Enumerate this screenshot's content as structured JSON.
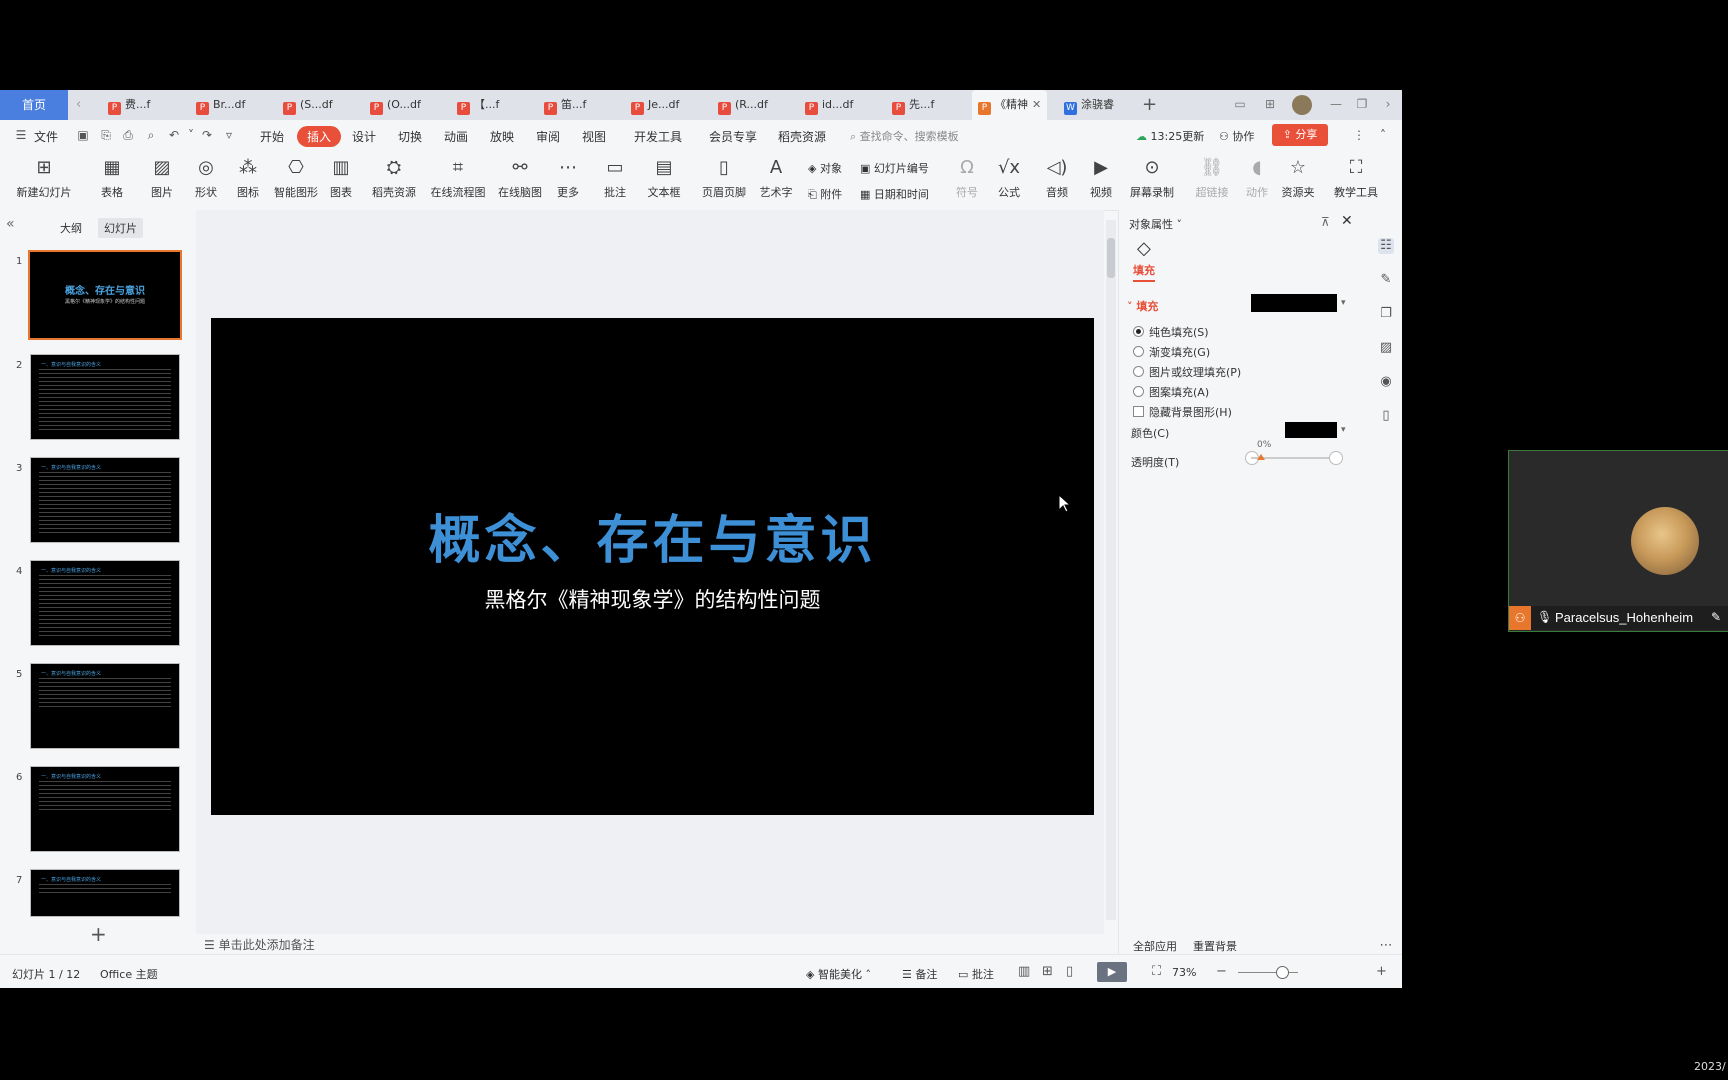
{
  "tabbar": {
    "home": "首页",
    "tabs": [
      {
        "label": "费...f",
        "type": "pdf"
      },
      {
        "label": "Br...df",
        "type": "pdf"
      },
      {
        "label": "(S...df",
        "type": "pdf"
      },
      {
        "label": "(O...df",
        "type": "pdf"
      },
      {
        "label": "【...f",
        "type": "pdf"
      },
      {
        "label": "笛...f",
        "type": "pdf"
      },
      {
        "label": "Je...df",
        "type": "pdf"
      },
      {
        "label": "(R...df",
        "type": "pdf"
      },
      {
        "label": "id...df",
        "type": "pdf"
      },
      {
        "label": "先...f",
        "type": "pdf"
      },
      {
        "label": "《精神",
        "type": "ppt"
      },
      {
        "label": "涂骁睿",
        "type": "wps"
      }
    ],
    "plus": "+"
  },
  "menubar": {
    "file": "文件",
    "items": [
      "开始",
      "插入",
      "设计",
      "切换",
      "动画",
      "放映",
      "审阅",
      "视图",
      "开发工具",
      "会员专享",
      "稻壳资源"
    ],
    "active": "插入",
    "search_placeholder": "查找命令、搜索模板",
    "sync_time": "13:25更新",
    "collab": "协作",
    "share": "分享"
  },
  "ribbon": {
    "items": [
      "新建幻灯片",
      "表格",
      "图片",
      "形状",
      "图标",
      "智能图形",
      "图表",
      "稻壳资源",
      "在线流程图",
      "在线脑图",
      "更多",
      "批注",
      "文本框",
      "页眉页脚",
      "艺术字"
    ],
    "small": [
      "对象",
      "附件",
      "幻灯片编号",
      "日期和时间"
    ],
    "right_items": [
      "符号",
      "公式",
      "音频",
      "视频",
      "屏幕录制",
      "超链接",
      "动作",
      "资源夹",
      "教学工具"
    ]
  },
  "leftpanel": {
    "tabs": [
      "大纲",
      "幻灯片"
    ],
    "active_tab": "幻灯片",
    "thumb1_title": "概念、存在与意识",
    "thumb1_sub": "黑格尔《精神现象学》的结构性问题",
    "thumb_heading": "一、意识与自我意识的含义",
    "slide_numbers": [
      "1",
      "2",
      "3",
      "4",
      "5",
      "6",
      "7"
    ],
    "add": "+"
  },
  "slide": {
    "title": "概念、存在与意识",
    "subtitle": "黑格尔《精神现象学》的结构性问题"
  },
  "notes": {
    "placeholder": "单击此处添加备注"
  },
  "properties": {
    "title": "对象属性",
    "fill_tab": "填充",
    "section": "填充",
    "options": [
      "纯色填充(S)",
      "渐变填充(G)",
      "图片或纹理填充(P)",
      "图案填充(A)"
    ],
    "hide_bg": "隐藏背景图形(H)",
    "color_label": "颜色(C)",
    "transparency_label": "透明度(T)",
    "transparency_value": "0%",
    "apply_all": "全部应用",
    "reset_bg": "重置背景",
    "colors": {
      "fill": "#000000"
    }
  },
  "statusbar": {
    "slide_count": "幻灯片 1 / 12",
    "theme": "Office 主题",
    "beautify": "智能美化",
    "notes": "备注",
    "comments": "批注",
    "zoom": "73%"
  },
  "video": {
    "name": "Paracelsus_Hohenheim"
  },
  "clock": "2023/"
}
